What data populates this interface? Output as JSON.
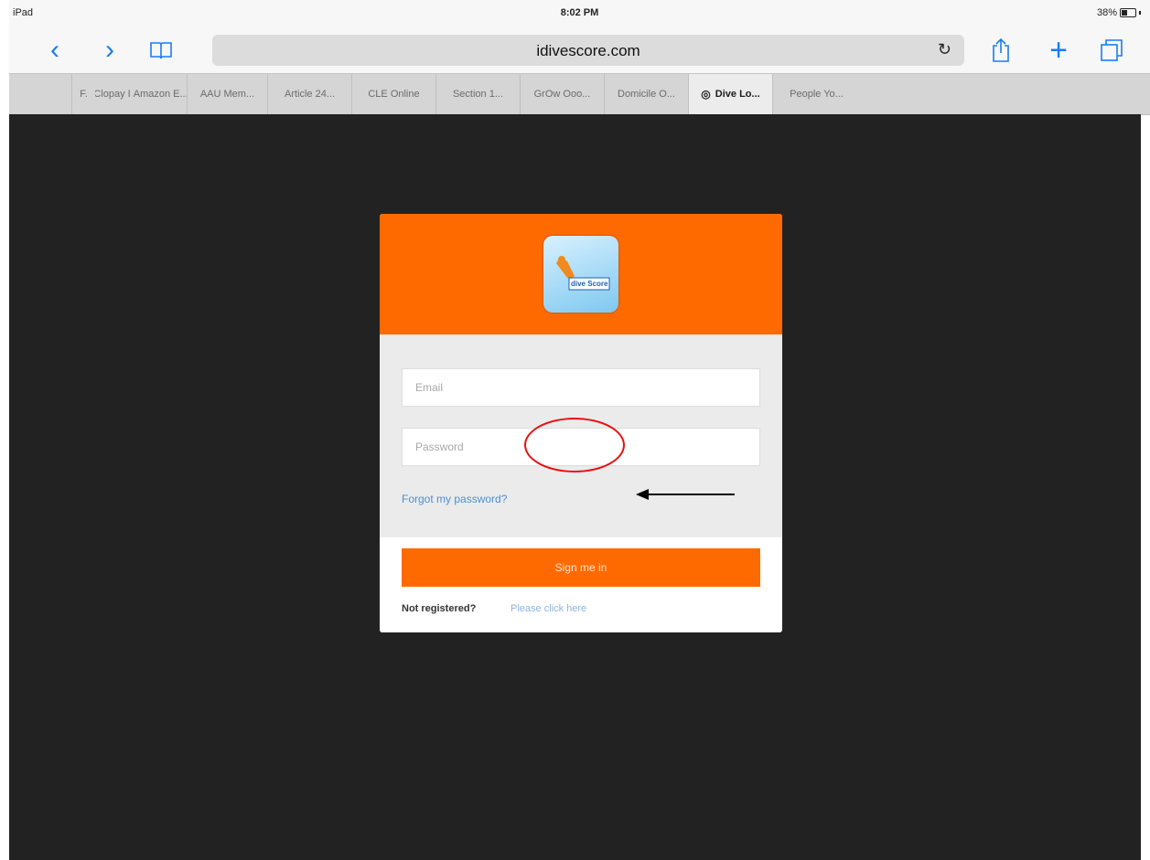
{
  "status_bar": {
    "device": "iPad",
    "time": "8:02 PM",
    "battery": "38%"
  },
  "browser": {
    "url": "idivescore.com",
    "tabs": [
      "F.",
      "Clopay I",
      "Amazon E...",
      "AAU Mem...",
      "Article 24...",
      "CLE Online",
      "Section 1...",
      "GrOw Ooo...",
      "Domicile O...",
      "Dive Lo...",
      "People Yo..."
    ],
    "active_tab_index": 9
  },
  "login": {
    "logo_text": "dive Score",
    "email_placeholder": "Email",
    "password_placeholder": "Password",
    "forgot_link": "Forgot my password?",
    "signin_label": "Sign me in",
    "not_registered": "Not registered?",
    "register_link": "Please click here"
  },
  "colors": {
    "accent": "#ff6a00",
    "page_background": "#222222",
    "annotation_red": "#e81010"
  }
}
